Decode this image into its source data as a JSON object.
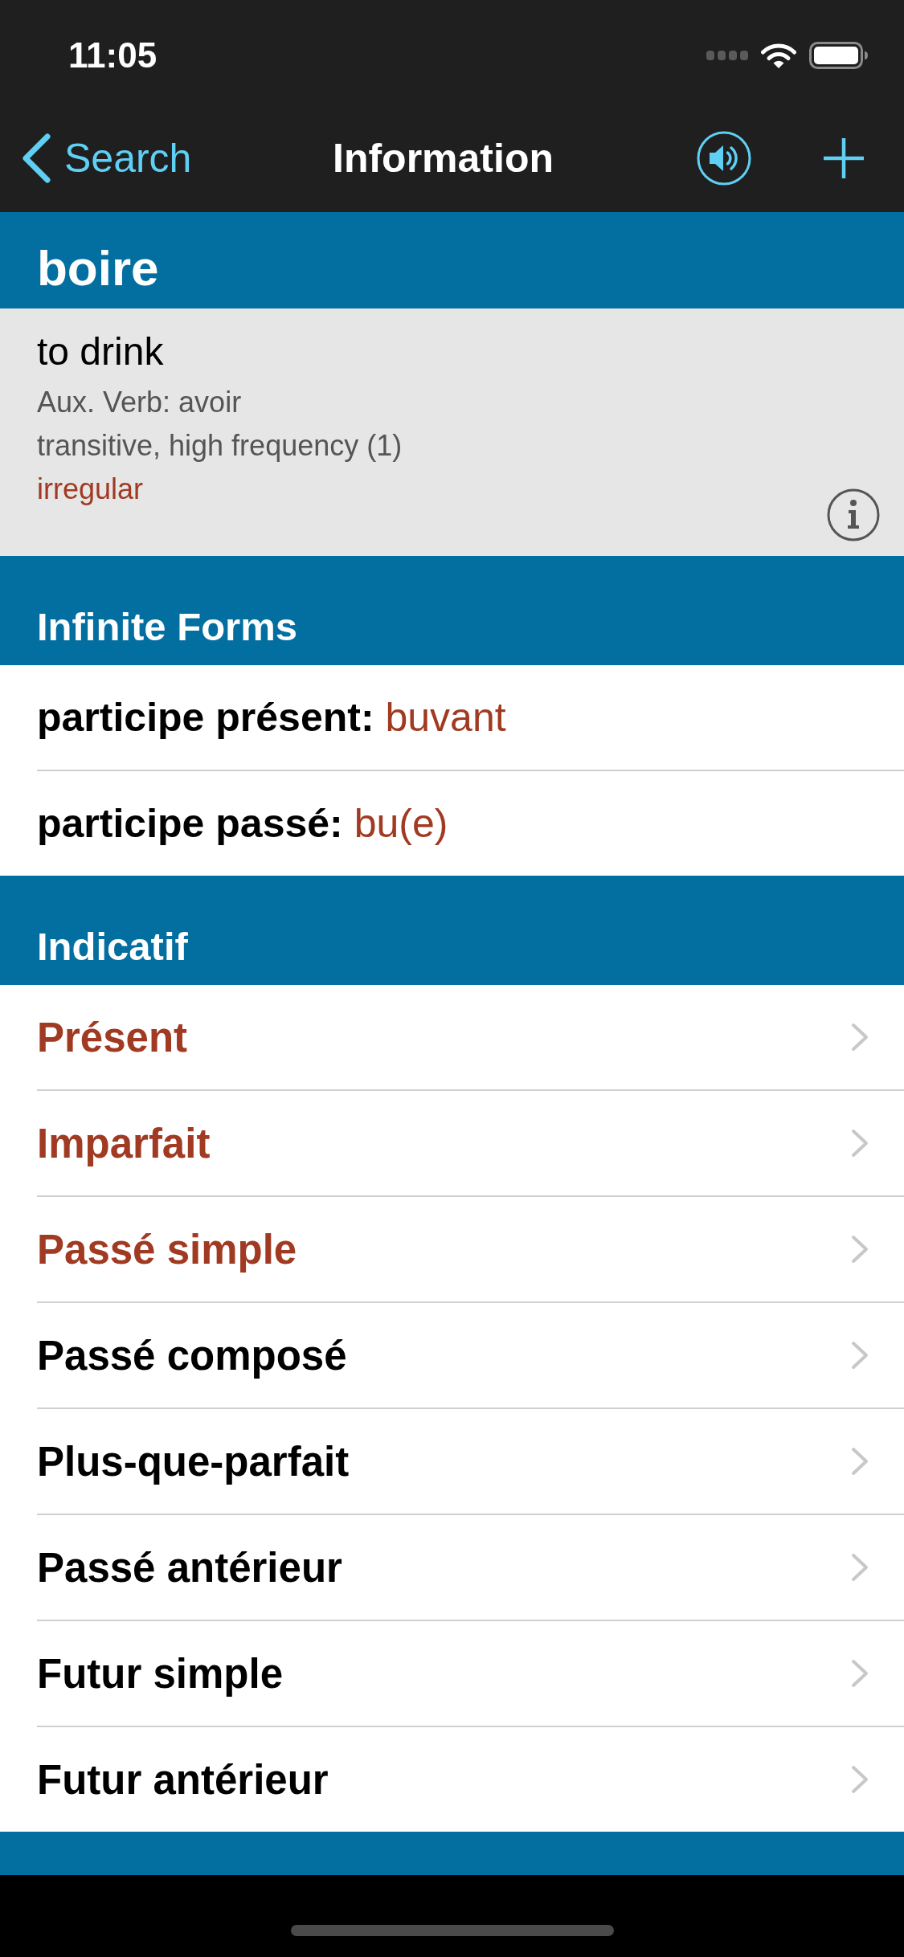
{
  "status_bar": {
    "time": "11:05"
  },
  "nav_bar": {
    "back_label": "Search",
    "title": "Information"
  },
  "entry": {
    "word": "boire",
    "translation": "to drink",
    "details": [
      {
        "text": "Aux. Verb: avoir",
        "kind": "note"
      },
      {
        "text": "transitive, high frequency (1)",
        "kind": "note"
      },
      {
        "text": "irregular",
        "kind": "irregular"
      }
    ]
  },
  "sections": [
    {
      "title": "Infinite Forms",
      "kind": "forms",
      "rows": [
        {
          "label": "participe présent:",
          "value": "buvant"
        },
        {
          "label": "participe passé:",
          "value": "bu(e)"
        }
      ]
    },
    {
      "title": "Indicatif",
      "kind": "tenses",
      "rows": [
        {
          "label": "Présent",
          "highlighted": true
        },
        {
          "label": "Imparfait",
          "highlighted": true
        },
        {
          "label": "Passé simple",
          "highlighted": true
        },
        {
          "label": "Passé composé",
          "highlighted": false
        },
        {
          "label": "Plus-que-parfait",
          "highlighted": false
        },
        {
          "label": "Passé antérieur",
          "highlighted": false
        },
        {
          "label": "Futur simple",
          "highlighted": false
        },
        {
          "label": "Futur antérieur",
          "highlighted": false
        }
      ]
    }
  ]
}
